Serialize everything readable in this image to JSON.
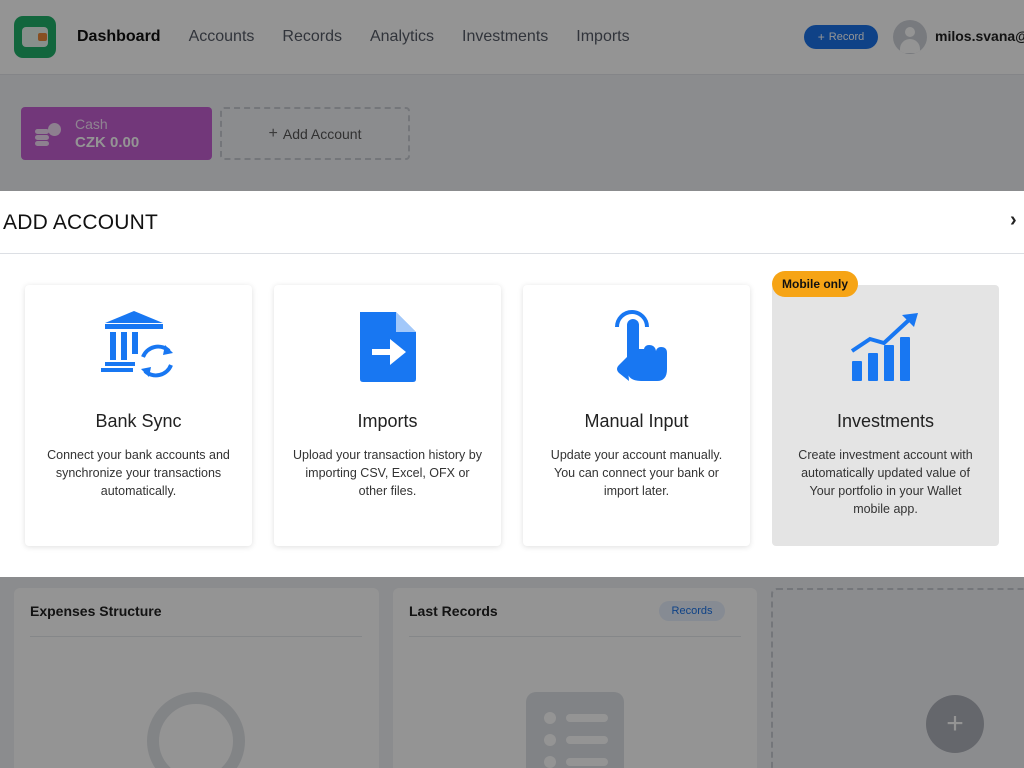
{
  "nav": {
    "items": [
      {
        "label": "Dashboard",
        "active": true
      },
      {
        "label": "Accounts",
        "active": false
      },
      {
        "label": "Records",
        "active": false
      },
      {
        "label": "Analytics",
        "active": false
      },
      {
        "label": "Investments",
        "active": false
      },
      {
        "label": "Imports",
        "active": false
      }
    ],
    "record_button": "Record",
    "username": "milos.svana@"
  },
  "accounts": {
    "cards": [
      {
        "name": "Cash",
        "balance": "CZK 0.00",
        "color": "#c45fd3"
      }
    ],
    "add_label": "Add Account"
  },
  "widgets": {
    "expenses_title": "Expenses Structure",
    "records_title": "Last Records",
    "records_badge": "Records"
  },
  "modal": {
    "title": "ADD ACCOUNT",
    "close_icon": "chevron-right-icon",
    "options": [
      {
        "title": "Bank Sync",
        "description": "Connect your bank accounts and synchronize your transactions automatically.",
        "icon": "bank-sync-icon",
        "enabled": true
      },
      {
        "title": "Imports",
        "description": "Upload your transaction history by importing CSV, Excel, OFX or other files.",
        "icon": "file-import-icon",
        "enabled": true
      },
      {
        "title": "Manual Input",
        "description": "Update your account manually. You can connect your bank or import later.",
        "icon": "hand-pointer-icon",
        "enabled": true
      },
      {
        "title": "Investments",
        "description": "Create investment account with automatically updated value of Your portfolio in your Wallet mobile app.",
        "icon": "investments-chart-icon",
        "enabled": false,
        "badge": "Mobile only"
      }
    ]
  },
  "colors": {
    "accent": "#1a73e8",
    "icon_blue": "#1877f2",
    "brand_green": "#20b06a",
    "badge_orange": "#f6a415",
    "cash_purple": "#c45fd3"
  }
}
